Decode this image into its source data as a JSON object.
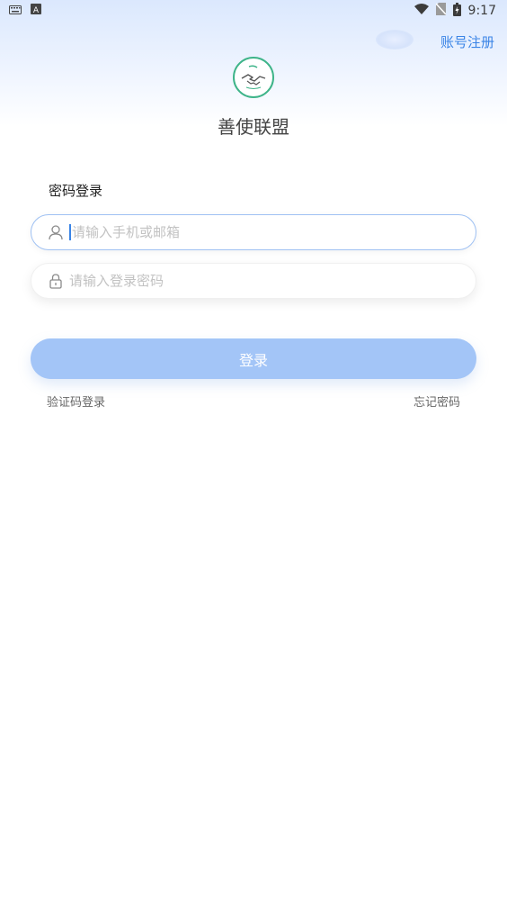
{
  "status_bar": {
    "time": "9:17",
    "left_icons": [
      "keyboard-icon",
      "a-badge-icon"
    ],
    "right_icons": [
      "wifi-icon",
      "no-sim-icon",
      "battery-icon"
    ]
  },
  "header": {
    "register_link": "账号注册",
    "app_name": "善使联盟",
    "logo_icon": "handshake-logo"
  },
  "form": {
    "title": "密码登录",
    "phone_placeholder": "请输入手机或邮箱",
    "phone_value": "",
    "password_placeholder": "请输入登录密码",
    "password_value": "",
    "login_button": "登录",
    "sms_login_link": "验证码登录",
    "forgot_password_link": "忘记密码"
  },
  "colors": {
    "accent": "#3a84e6",
    "button": "#a3c5f7",
    "logo_ring": "#3eb489"
  }
}
